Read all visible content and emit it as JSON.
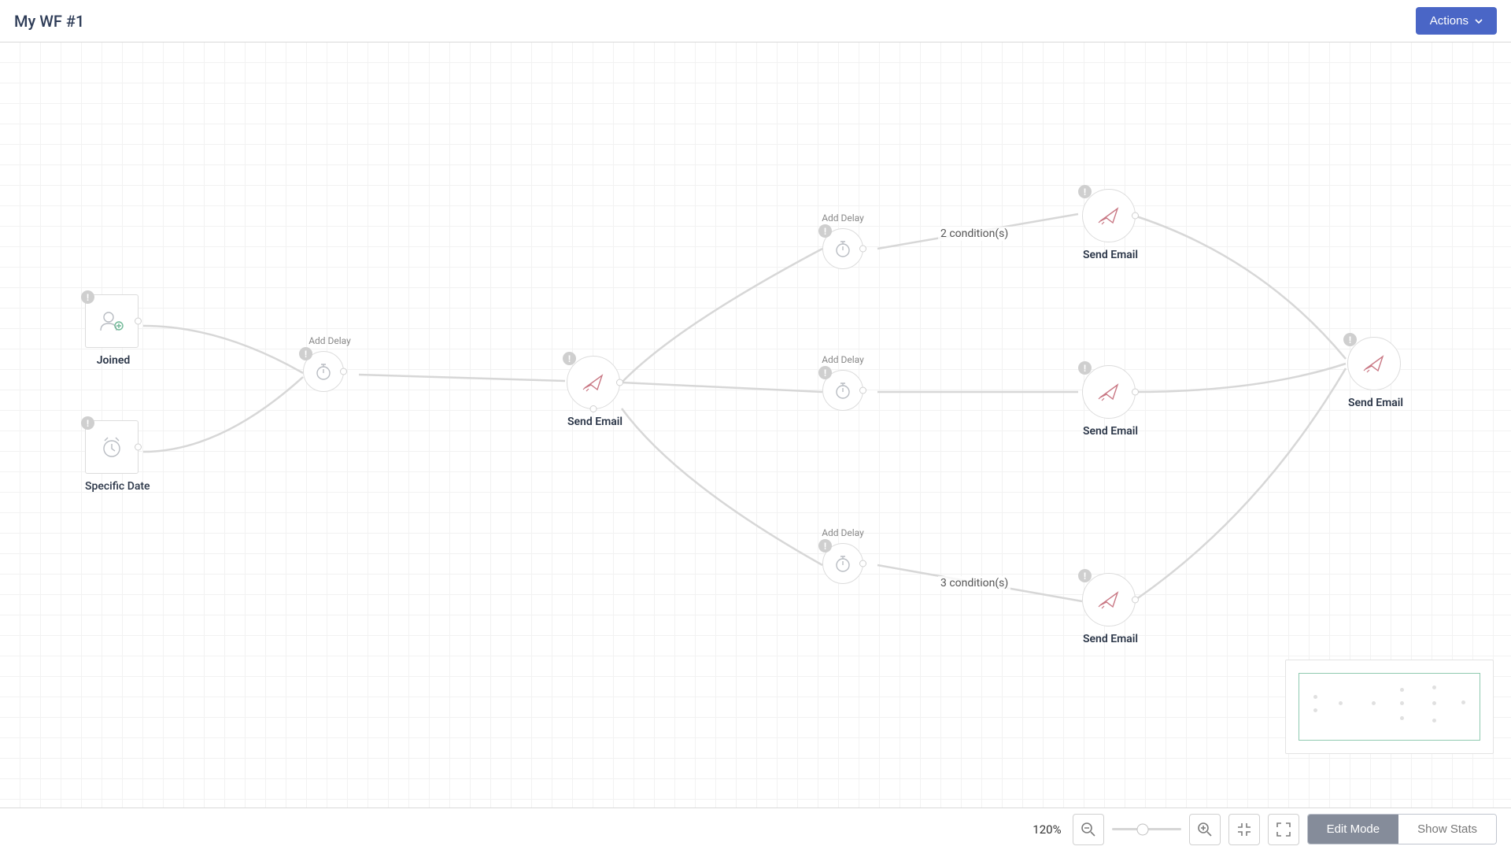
{
  "header": {
    "title": "My WF #1",
    "actions_label": "Actions"
  },
  "nodes": {
    "joined": {
      "label": "Joined"
    },
    "specific_date": {
      "label": "Specific Date"
    },
    "delay1": {
      "top_label": "Add Delay"
    },
    "send1": {
      "label": "Send Email"
    },
    "delay_top": {
      "top_label": "Add Delay"
    },
    "delay_mid": {
      "top_label": "Add Delay"
    },
    "delay_bot": {
      "top_label": "Add Delay"
    },
    "send_top": {
      "label": "Send Email"
    },
    "send_mid": {
      "label": "Send Email"
    },
    "send_bot": {
      "label": "Send Email"
    },
    "send_final": {
      "label": "Send Email"
    }
  },
  "edges": {
    "cond_top": "2 condition(s)",
    "cond_bot": "3 condition(s)"
  },
  "toolbar": {
    "zoom": "120%",
    "edit_mode": "Edit Mode",
    "show_stats": "Show Stats"
  },
  "icons": {
    "caret_down": "caret-down-icon",
    "zoom_out": "zoom-out-icon",
    "zoom_in": "zoom-in-icon",
    "fit": "fit-icon",
    "fullscreen": "fullscreen-icon",
    "user_plus": "user-plus-icon",
    "clock": "clock-icon",
    "stopwatch": "stopwatch-icon",
    "paper_plane": "paper-plane-icon",
    "alert": "alert-icon"
  }
}
